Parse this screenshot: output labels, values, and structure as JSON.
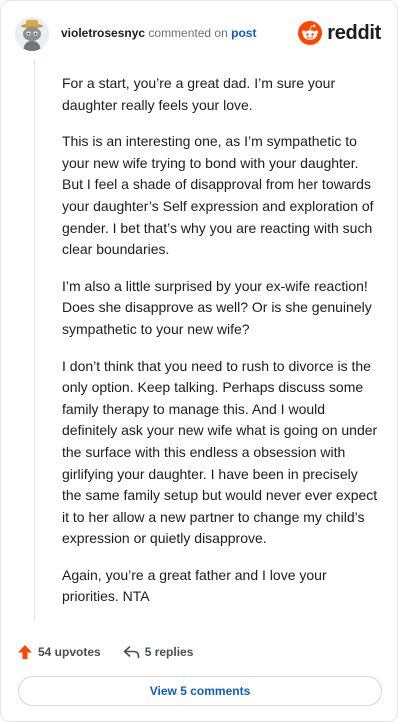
{
  "header": {
    "username": "violetrosesnyc",
    "action_text": "commented on",
    "post_link": "post",
    "brand_name": "reddit",
    "brand_color": "#ff4500"
  },
  "comment": {
    "paragraphs": [
      "For a start, you’re a great dad. I’m sure your daughter really feels your love.",
      "This is an interesting one, as I’m sympathetic to your new wife trying to bond with your daughter. But I feel a shade of disapproval from her towards your daughter’s Self expression and exploration of gender. I bet that’s why you are reacting with such clear boundaries.",
      "I’m also a little surprised by your ex-wife reaction! Does she disapprove as well? Or is she genuinely sympathetic to your new wife?",
      "I don’t think that you need to rush to divorce is the only option. Keep talking. Perhaps discuss some family therapy to manage this. And I would definitely ask your new wife what is going on under the surface with this endless a obsession with girlifying your daughter. I have been in precisely the same family setup but would never ever expect it to her allow a new partner to change my child’s expression or quietly disapprove.",
      "Again, you’re a great father and I love your priorities. NTA"
    ]
  },
  "actions": {
    "upvotes_label": "54 upvotes",
    "replies_label": "5 replies",
    "upvote_icon": "upvote-arrow-icon",
    "reply_icon": "reply-arrow-icon",
    "upvote_color": "#ff4500"
  },
  "footer": {
    "view_comments_label": "View 5 comments",
    "link_color": "#0a5ec2"
  }
}
